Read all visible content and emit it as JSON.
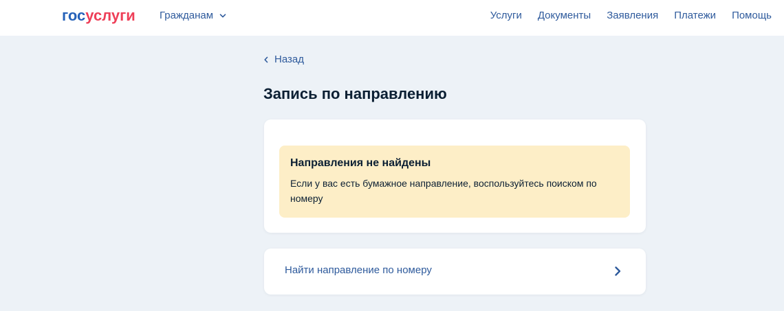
{
  "header": {
    "logo": {
      "part1": "гос",
      "part2": "услуги"
    },
    "audience": {
      "label": "Гражданам",
      "icon": "chevron-down-icon"
    },
    "nav": [
      "Услуги",
      "Документы",
      "Заявления",
      "Платежи",
      "Помощь"
    ]
  },
  "back": {
    "label": "Назад",
    "icon": "chevron-left-icon"
  },
  "page_title": "Запись по направлению",
  "notice": {
    "title": "Направления не найдены",
    "text": "Если у вас есть бумажное направление, воспользуйтесь поиском по номеру"
  },
  "search_link": {
    "label": "Найти направление по номеру",
    "icon": "chevron-right-icon"
  },
  "colors": {
    "background": "#edf2f7",
    "link": "#2e5a9c",
    "logo_gos": "#2662b9",
    "logo_uslugi": "#ee3f58",
    "notice_bg": "#fdeec7",
    "text": "#0b1f33"
  }
}
